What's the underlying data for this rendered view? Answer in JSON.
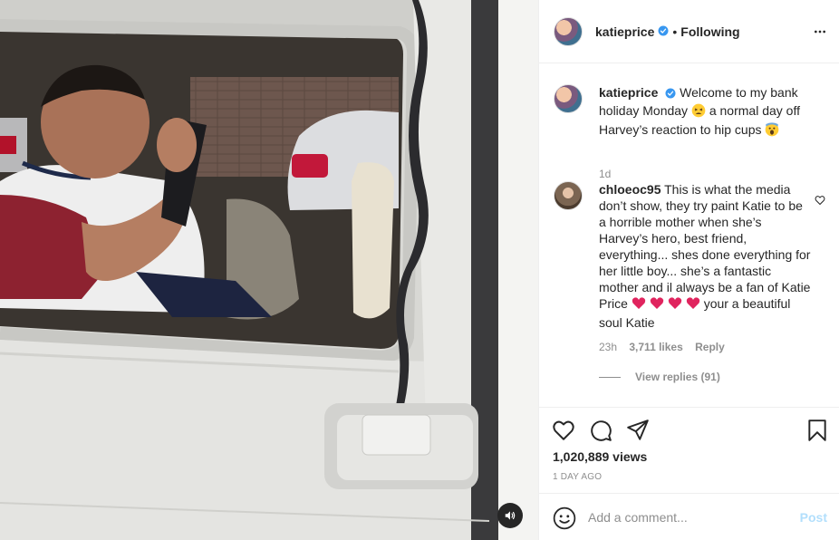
{
  "post": {
    "username": "katieprice",
    "following_label": "Following",
    "separator": "•"
  },
  "caption": {
    "username": "katieprice",
    "text_part1": "Welcome to my bank holiday Monday",
    "text_part2": "a normal day off Harvey’s reaction to hip cups",
    "time": "1d"
  },
  "comment": {
    "username": "chloeoc95",
    "text_part1": "This is what the media don’t show, they try paint Katie to be a horrible mother when she’s Harvey’s hero, best friend, everything... shes done everything for her little boy... she’s a fantastic mother and il always be a fan of Katie Price",
    "text_part2": "your a beautiful soul Katie",
    "time": "23h",
    "likes": "3,711 likes",
    "reply_label": "Reply",
    "view_replies": "View replies (91)"
  },
  "stats": {
    "views": "1,020,889 views",
    "posted": "1 DAY AGO"
  },
  "add_comment": {
    "placeholder": "Add a comment...",
    "post_label": "Post"
  },
  "colors": {
    "verified": "#3897f0",
    "post_disabled": "#b2dffc",
    "muted": "#8e8e8e",
    "heart_red": "#e0245e"
  },
  "icons": {
    "header": [
      "verified-badge",
      "more-options"
    ],
    "actions": [
      "heart",
      "comment-bubble",
      "share-paper-plane",
      "bookmark"
    ],
    "media": [
      "speaker"
    ],
    "input": [
      "emoji-smiley"
    ]
  }
}
